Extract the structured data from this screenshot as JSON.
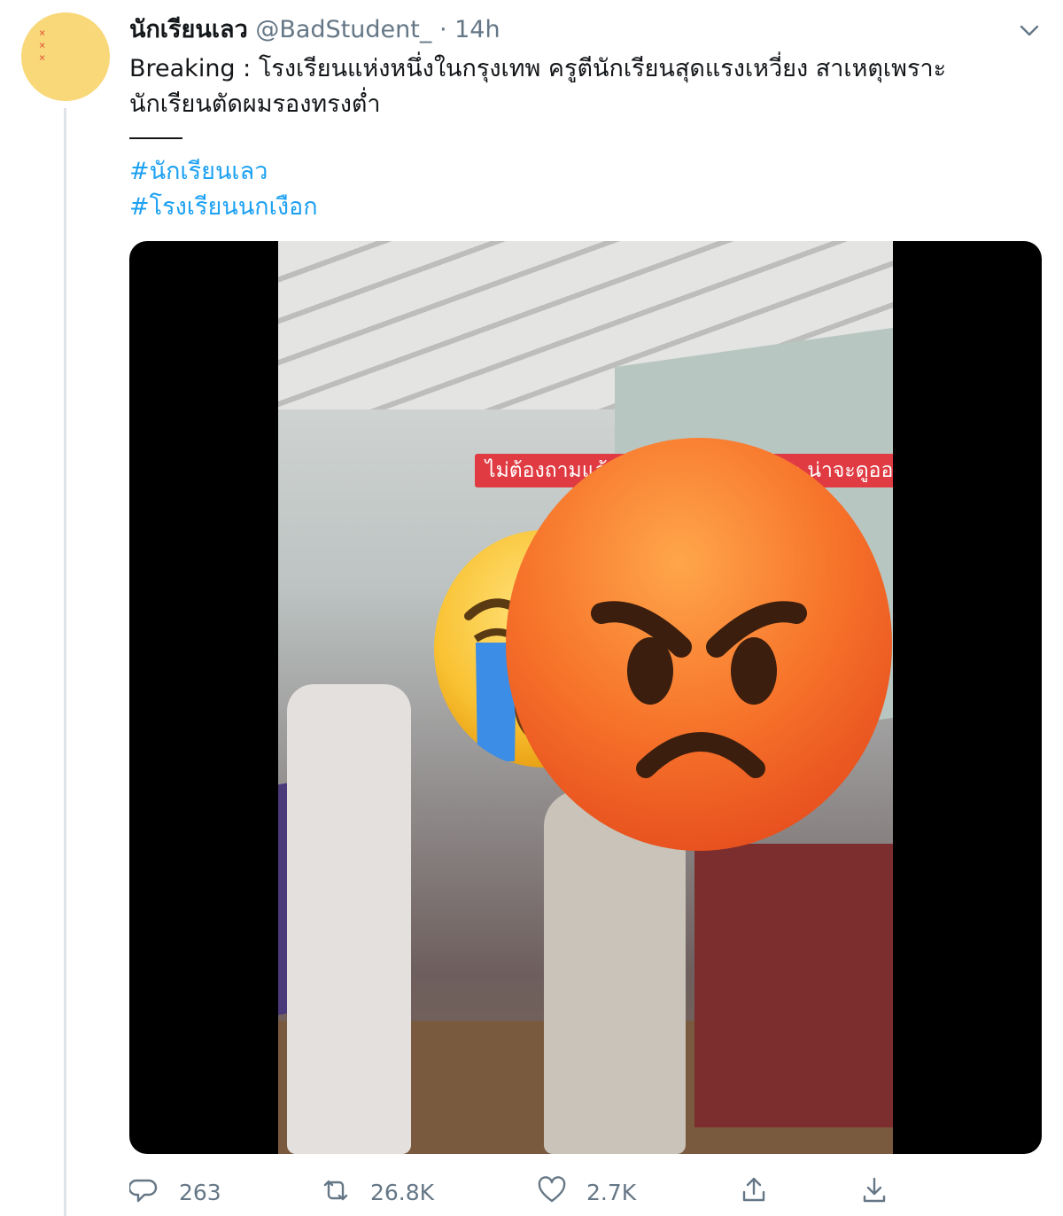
{
  "tweet": {
    "display_name": "นักเรียนเลว",
    "handle": "@BadStudent_",
    "separator": "·",
    "time": "14h",
    "text_lines": [
      "Breaking : โรงเรียนแห่งหนึ่งในกรุงเทพ ครูตีนักเรียนสุดแรงเหวี่ยง สาเหตุเพราะ",
      "นักเรียนตัดผมรองทรงต่ำ"
    ],
    "hashtags": [
      "#นักเรียนเลว",
      "#โรงเรียนนกเงือก"
    ],
    "media": {
      "caption": "ไม่ต้องถามแล้วว่าใคร ดูกันเองนะคะ น่าจะดูออกกัน"
    }
  },
  "actions": {
    "replies": "263",
    "retweets": "26.8K",
    "likes": "2.7K"
  },
  "icons": {
    "caret": "chevron-down-icon",
    "reply": "reply-icon",
    "retweet": "retweet-icon",
    "like": "heart-icon",
    "share": "share-icon",
    "download": "download-icon",
    "emoji_face_left": "loudly-crying-face-emoji",
    "emoji_face_right": "angry-face-emoji"
  },
  "colors": {
    "link": "#1da1f2",
    "muted": "#657786",
    "avatar": "#f8d878",
    "caption_bg": "#e03a42"
  }
}
